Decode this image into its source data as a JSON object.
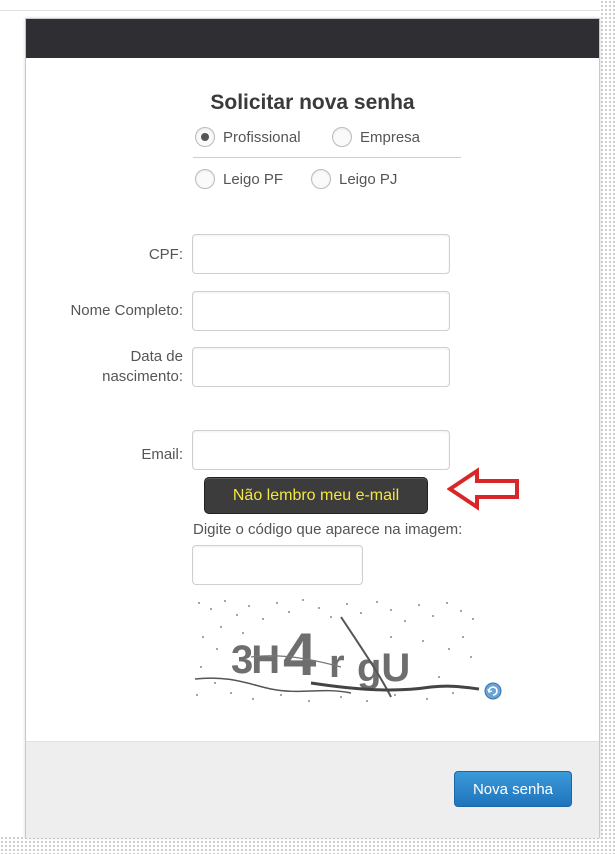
{
  "dialog": {
    "title": "Solicitar nova senha"
  },
  "user_types": [
    {
      "label": "Profissional",
      "selected": true
    },
    {
      "label": "Empresa",
      "selected": false
    },
    {
      "label": "Leigo PF",
      "selected": false
    },
    {
      "label": "Leigo PJ",
      "selected": false
    }
  ],
  "form": {
    "cpf_label": "CPF:",
    "name_label": "Nome Completo:",
    "birth_label_line1": "Data de",
    "birth_label_line2": "nascimento:",
    "email_label": "Email:",
    "cpf_value": "",
    "name_value": "",
    "birth_value": "",
    "email_value": ""
  },
  "forgot_email_button": "Não lembro meu e-mail",
  "captcha": {
    "hint": "Digite o código que aparece na imagem:",
    "value": "",
    "image_text": "3H4rgU"
  },
  "footer": {
    "submit_label": "Nova senha"
  },
  "colors": {
    "header": "#2e2e33",
    "forgot_button_bg": "#3c3c3c",
    "forgot_button_text": "#f2e640",
    "submit_button": "#2a86cc",
    "arrow": "#d9262b"
  }
}
